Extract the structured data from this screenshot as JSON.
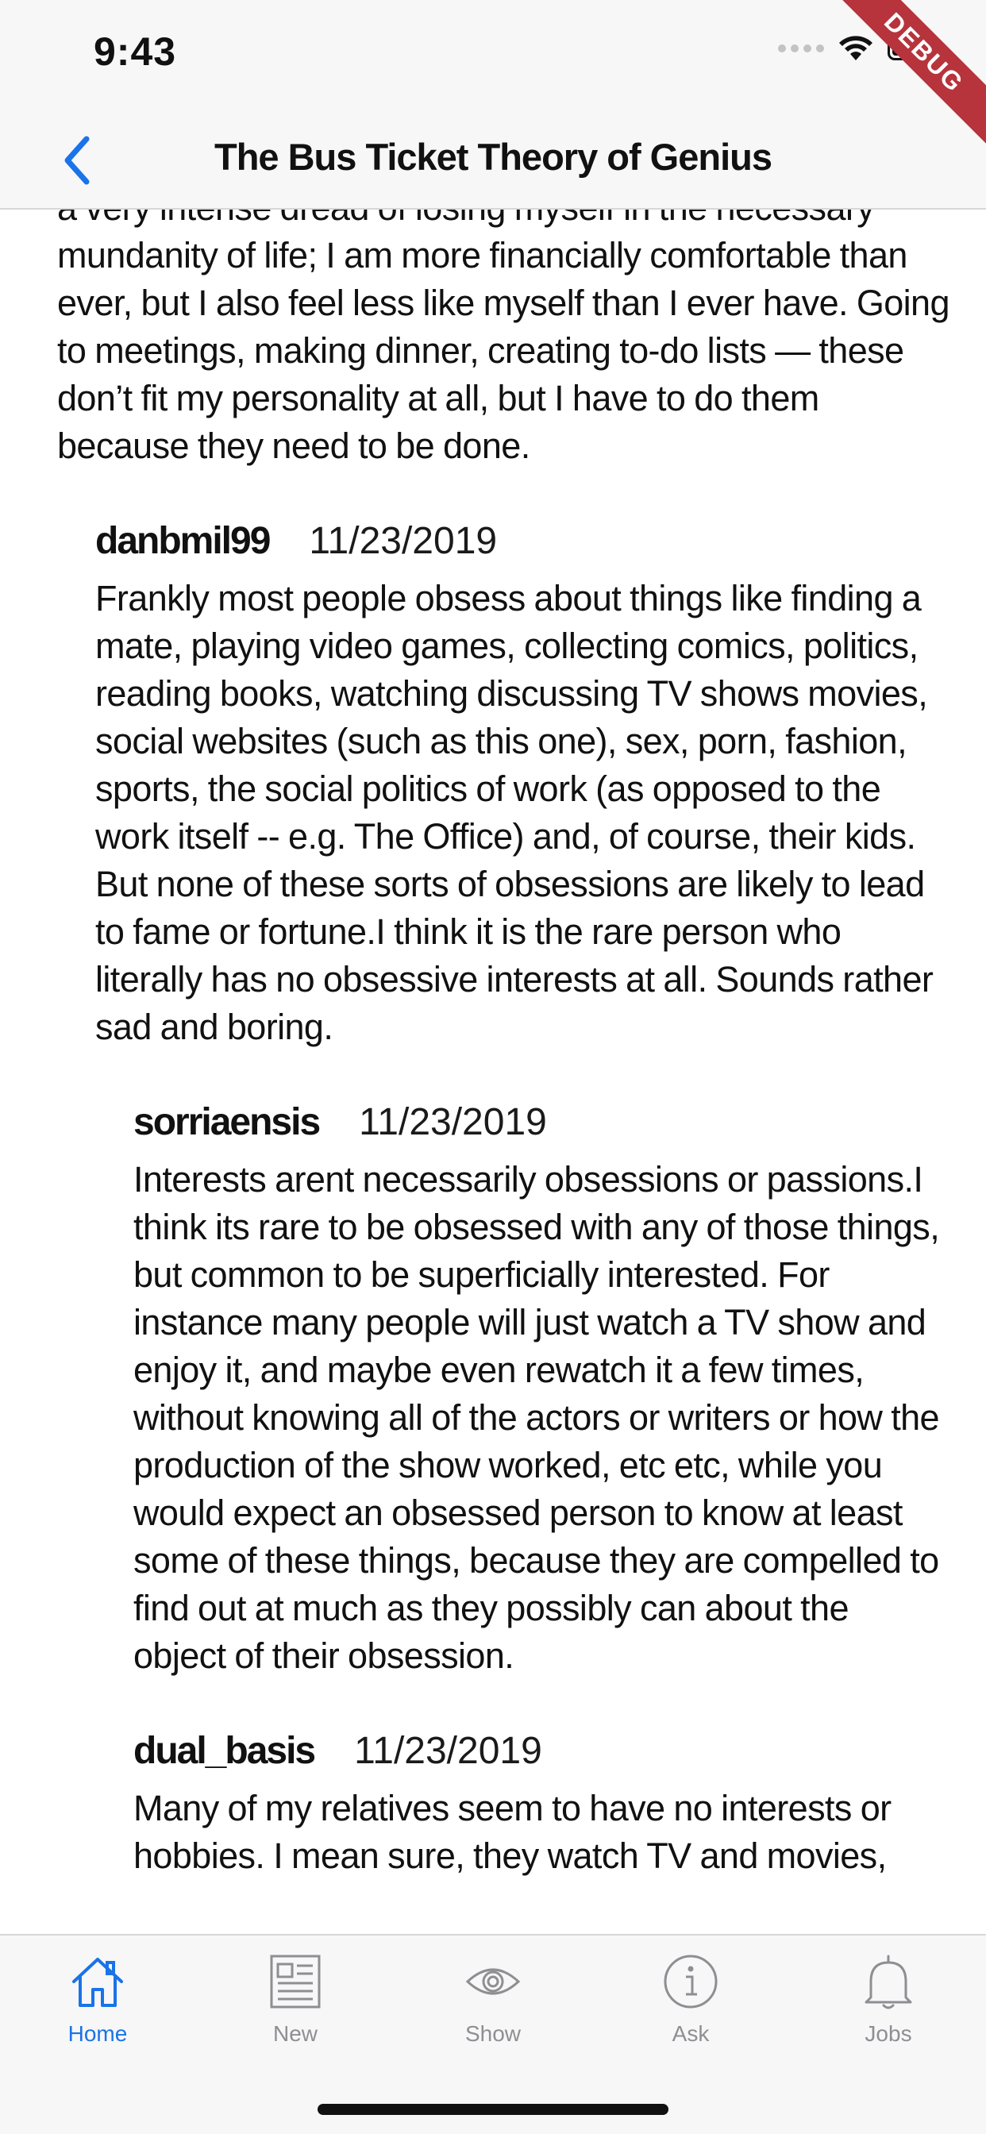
{
  "status_bar": {
    "time": "9:43"
  },
  "debug_banner": {
    "label": "DEBUG"
  },
  "nav": {
    "title": "The Bus Ticket Theory of Genius",
    "back_icon": "chevron-left-icon"
  },
  "comments": [
    {
      "author": "",
      "date": "",
      "level": 0,
      "partial": true,
      "body": "a very intense dread of losing myself in the necessary mundanity of life; I am more financially comfortable than ever, but I also feel less like myself than I ever have. Going to meetings, making dinner, creating to-do lists — these don’t fit my personality at all, but I have to do them because they need to be done."
    },
    {
      "author": "danbmil99",
      "date": "11/23/2019",
      "level": 1,
      "body": "Frankly most people obsess about things like finding a mate, playing video games, collecting comics, politics, reading books, watching  discussing TV shows  movies, social websites (such as this one), sex, porn, fashion, sports, the social politics of work (as opposed to the work itself -- e.g. The Office) and, of course, their kids. But none of these sorts of obsessions are likely to lead to fame or fortune.I think it is the rare person who literally has no obsessive interests at all. Sounds rather sad and boring."
    },
    {
      "author": "sorriaensis",
      "date": "11/23/2019",
      "level": 2,
      "body": "Interests arent necessarily obsessions or passions.I think its rare to be obsessed with any of those things, but common to be superficially interested. For instance many people will just watch a TV show and enjoy it, and maybe even rewatch it a few times, without knowing all of the actors or writers or how the production of the show worked, etc etc, while you would expect an obsessed person to know at least some of these things, because they are compelled to find out at much as they possibly can about the object of their obsession."
    },
    {
      "author": "dual_basis",
      "date": "11/23/2019",
      "level": 2,
      "body": "Many of my relatives seem to have no interests or hobbies. I mean sure, they watch TV and movies,"
    }
  ],
  "tabs": [
    {
      "label": "Home",
      "icon": "home-icon",
      "active": true
    },
    {
      "label": "New",
      "icon": "newspaper-icon",
      "active": false
    },
    {
      "label": "Show",
      "icon": "eye-icon",
      "active": false
    },
    {
      "label": "Ask",
      "icon": "info-icon",
      "active": false
    },
    {
      "label": "Jobs",
      "icon": "bell-icon",
      "active": false
    }
  ],
  "colors": {
    "accent": "#1a73e8",
    "inactive": "#8e8e93",
    "bar_background": "#f7f7f7",
    "debug_ribbon": "#b7343c"
  }
}
